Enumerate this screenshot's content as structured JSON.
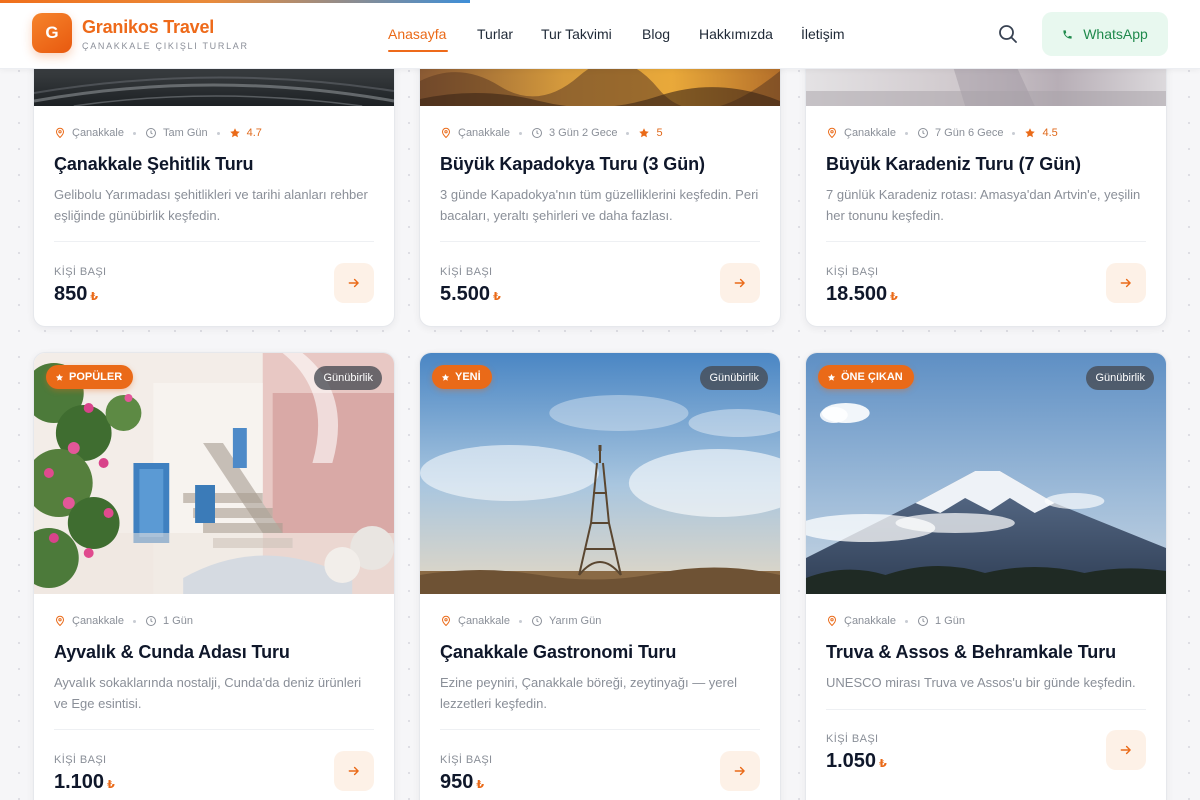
{
  "brand": {
    "logo_letter": "G",
    "name": "Granikos Travel",
    "tagline": "ÇANAKKALE ÇIKIŞLI TURLAR"
  },
  "nav": {
    "items": [
      {
        "label": "Anasayfa",
        "active": true
      },
      {
        "label": "Turlar"
      },
      {
        "label": "Tur Takvimi"
      },
      {
        "label": "Blog"
      },
      {
        "label": "Hakkımızda"
      },
      {
        "label": "İletişim"
      }
    ],
    "whatsapp_label": "WhatsApp"
  },
  "cards": [
    {
      "location": "Çanakkale",
      "duration": "Tam Gün",
      "rating": "4.7",
      "title": "Çanakkale Şehitlik Turu",
      "description": "Gelibolu Yarımadası şehitlikleri ve tarihi alanları rehber eşliğinde günübirlik keşfedin.",
      "price_label": "KİŞİ BAŞI",
      "price": "850",
      "currency": "₺"
    },
    {
      "location": "Çanakkale",
      "duration": "3 Gün 2 Gece",
      "rating": "5",
      "title": "Büyük Kapadokya Turu (3 Gün)",
      "description": "3 günde Kapadokya'nın tüm güzelliklerini keşfedin. Peri bacaları, yeraltı şehirleri ve daha fazlası.",
      "price_label": "KİŞİ BAŞI",
      "price": "5.500",
      "currency": "₺"
    },
    {
      "location": "Çanakkale",
      "duration": "7 Gün 6 Gece",
      "rating": "4.5",
      "title": "Büyük Karadeniz Turu (7 Gün)",
      "description": "7 günlük Karadeniz rotası: Amasya'dan Artvin'e, yeşilin her tonunu keşfedin.",
      "price_label": "KİŞİ BAŞI",
      "price": "18.500",
      "currency": "₺"
    },
    {
      "badge": "POPÜLER",
      "type": "Günübirlik",
      "location": "Çanakkale",
      "duration": "1 Gün",
      "title": "Ayvalık & Cunda Adası Turu",
      "description": "Ayvalık sokaklarında nostalji, Cunda'da deniz ürünleri ve Ege esintisi.",
      "price_label": "KİŞİ BAŞI",
      "price": "1.100",
      "currency": "₺"
    },
    {
      "badge": "YENİ",
      "type": "Günübirlik",
      "location": "Çanakkale",
      "duration": "Yarım Gün",
      "title": "Çanakkale Gastronomi Turu",
      "description": "Ezine peyniri, Çanakkale böreği, zeytinyağı — yerel lezzetleri keşfedin.",
      "price_label": "KİŞİ BAŞI",
      "price": "950",
      "currency": "₺"
    },
    {
      "badge": "ÖNE ÇIKAN",
      "type": "Günübirlik",
      "location": "Çanakkale",
      "duration": "1 Gün",
      "title": "Truva & Assos & Behramkale Turu",
      "description": "UNESCO mirası Truva ve Assos'u bir günde keşfedin.",
      "price_label": "KİŞİ BAŞI",
      "price": "1.050",
      "currency": "₺"
    }
  ],
  "colors": {
    "accent": "#ea6a18",
    "accent_soft": "#fdf1e7",
    "whatsapp_bg": "#e8f8ef",
    "whatsapp_text": "#1f8a4c",
    "text_dark": "#0f172a",
    "text_muted": "#8a8f98"
  },
  "icons": {
    "meta": [
      "location-pin-icon",
      "clock-icon",
      "star-icon"
    ],
    "header": [
      "search-icon",
      "phone-icon"
    ],
    "card_action": "arrow-right-icon"
  }
}
